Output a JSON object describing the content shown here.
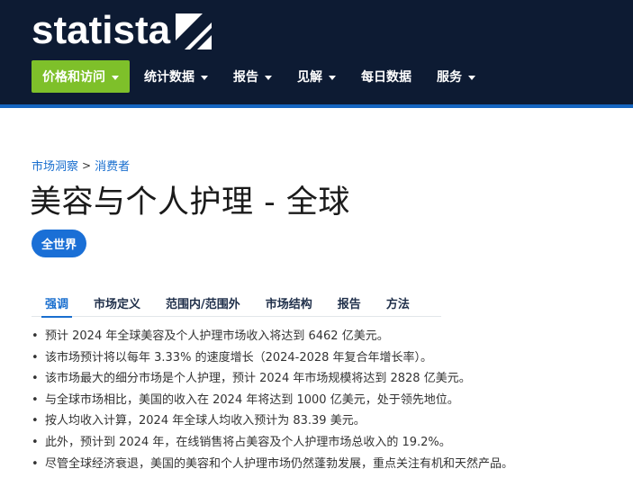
{
  "brand": {
    "logo_text": "statista"
  },
  "nav": {
    "items": [
      {
        "label": "价格和访问",
        "has_dropdown": true,
        "active": true
      },
      {
        "label": "统计数据",
        "has_dropdown": true
      },
      {
        "label": "报告",
        "has_dropdown": true
      },
      {
        "label": "见解",
        "has_dropdown": true
      },
      {
        "label": "每日数据",
        "has_dropdown": false
      },
      {
        "label": "服务",
        "has_dropdown": true
      }
    ],
    "active_color": "#7ec02a",
    "background_color": "#0d1b33",
    "accent_color": "#1565c0"
  },
  "breadcrumb": {
    "items": [
      "市场洞察",
      "消费者"
    ],
    "separator": ">"
  },
  "page": {
    "title": "美容与个人护理 - 全球",
    "region_badge": "全世界"
  },
  "tabs": {
    "items": [
      "强调",
      "市场定义",
      "范围内/范围外",
      "市场结构",
      "报告",
      "方法"
    ],
    "active_index": 0,
    "active_color": "#1a6fcf"
  },
  "highlights": [
    "预计 2024 年全球美容及个人护理市场收入将达到 6462 亿美元。",
    "该市场预计将以每年 3.33% 的速度增长（2024-2028 年复合年增长率）。",
    "该市场最大的细分市场是个人护理，预计 2024 年市场规模将达到 2828 亿美元。",
    "与全球市场相比，美国的收入在 2024 年将达到 1000 亿美元，处于领先地位。",
    "按人均收入计算，2024 年全球人均收入预计为 83.39 美元。",
    "此外，预计到 2024 年，在线销售将占美容及个人护理市场总收入的 19.2%。",
    "尽管全球经济衰退，美国的美容和个人护理市场仍然蓬勃发展，重点关注有机和天然产品。"
  ]
}
